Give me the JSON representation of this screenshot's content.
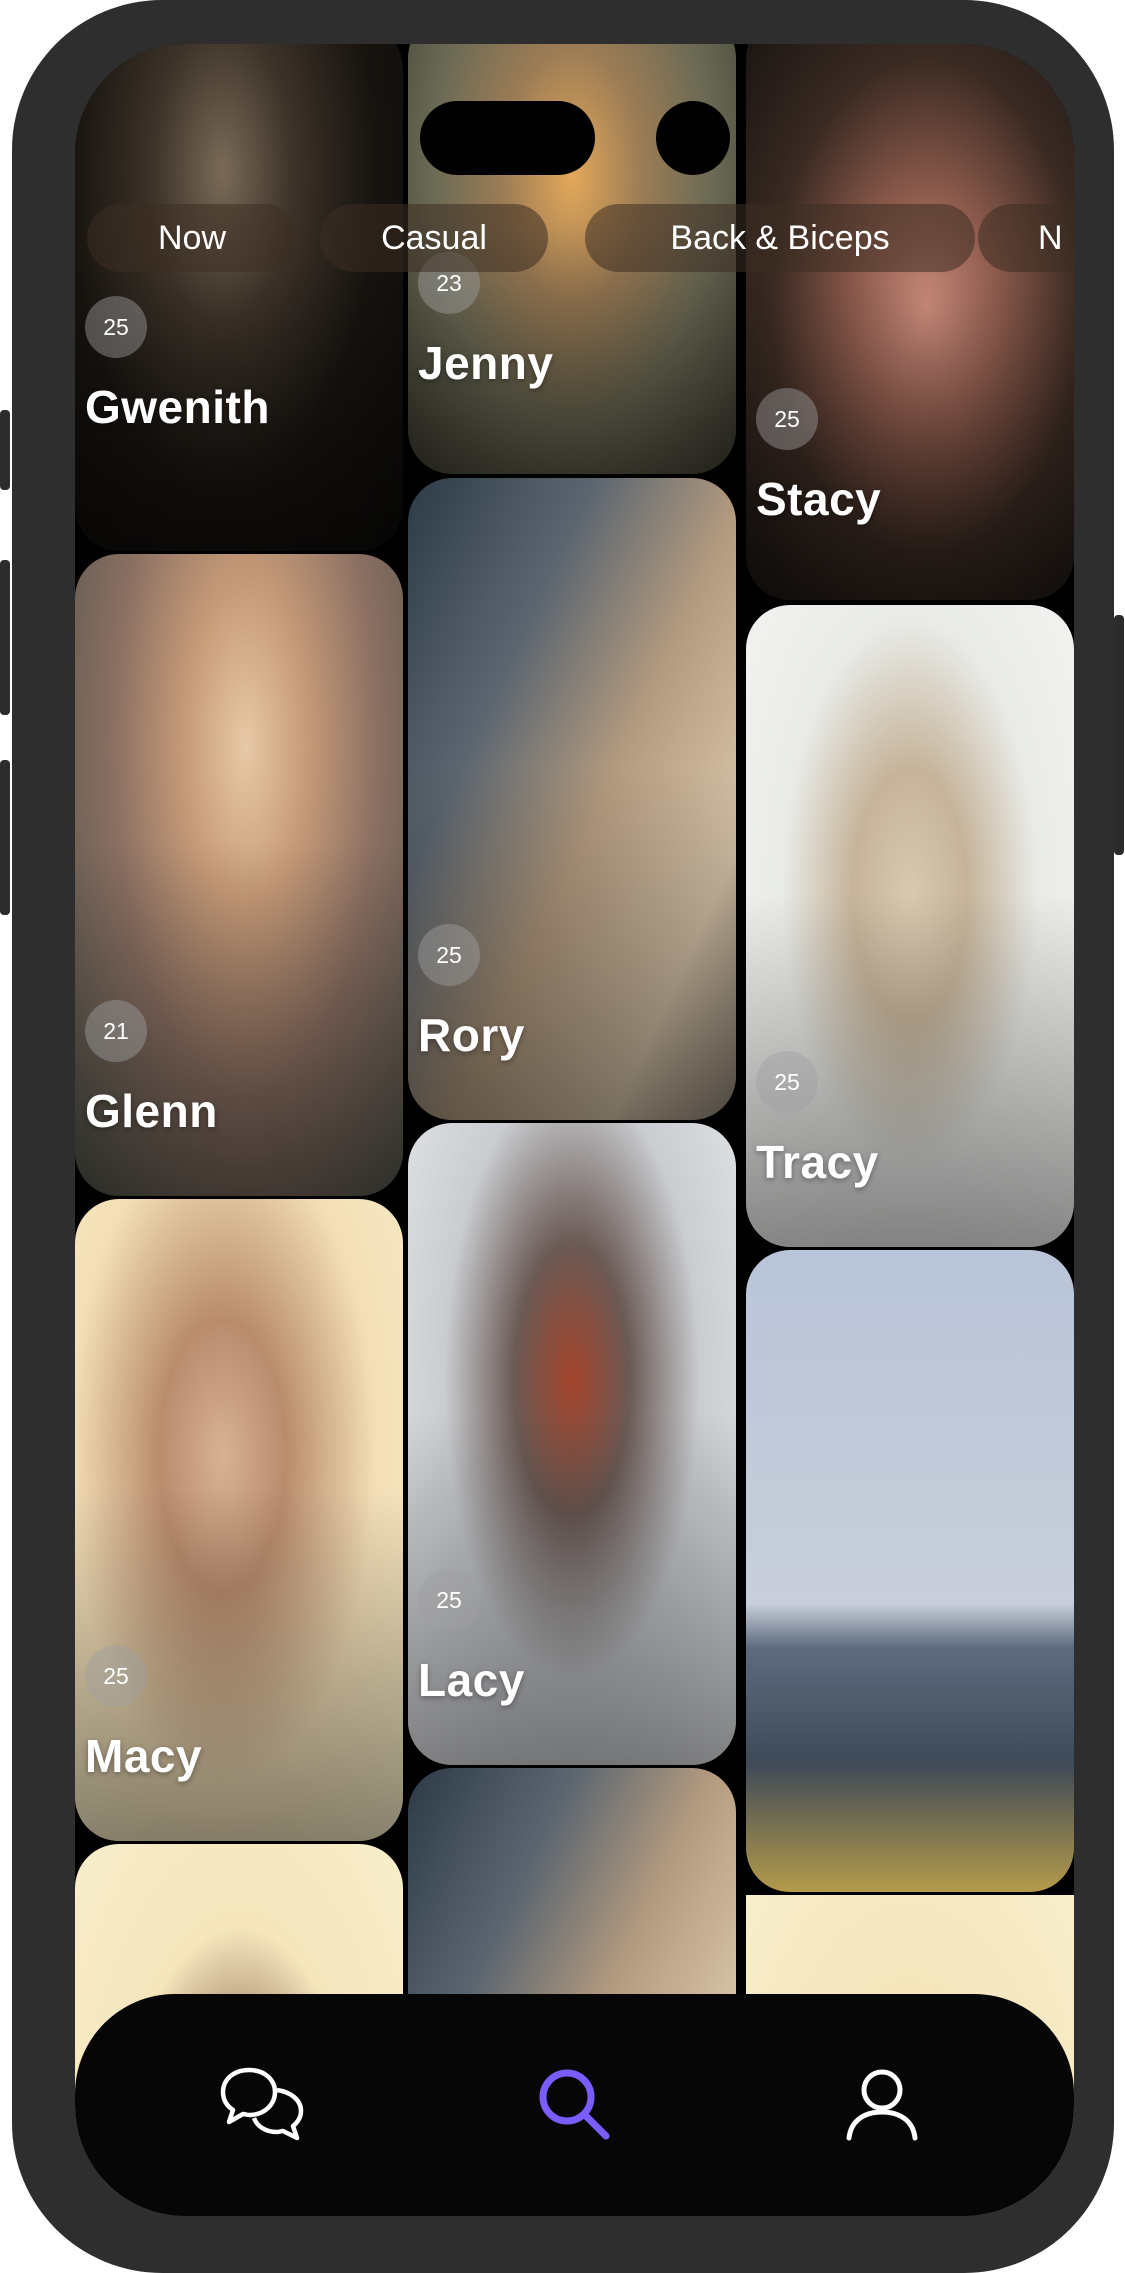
{
  "filters": [
    "Now",
    "Casual",
    "Back & Biceps",
    "N"
  ],
  "profiles": [
    {
      "name": "Gwenith",
      "age": "25"
    },
    {
      "name": "Jenny",
      "age": "23"
    },
    {
      "name": "Stacy",
      "age": "25"
    },
    {
      "name": "Glenn",
      "age": "21"
    },
    {
      "name": "Rory",
      "age": "25"
    },
    {
      "name": "Tracy",
      "age": "25"
    },
    {
      "name": "Macy",
      "age": "25"
    },
    {
      "name": "Lacy",
      "age": "25"
    }
  ],
  "nav": {
    "chat_icon": "chat-bubbles-icon",
    "search_icon": "search-icon",
    "profile_icon": "user-icon",
    "active_color": "#7b5cff"
  }
}
